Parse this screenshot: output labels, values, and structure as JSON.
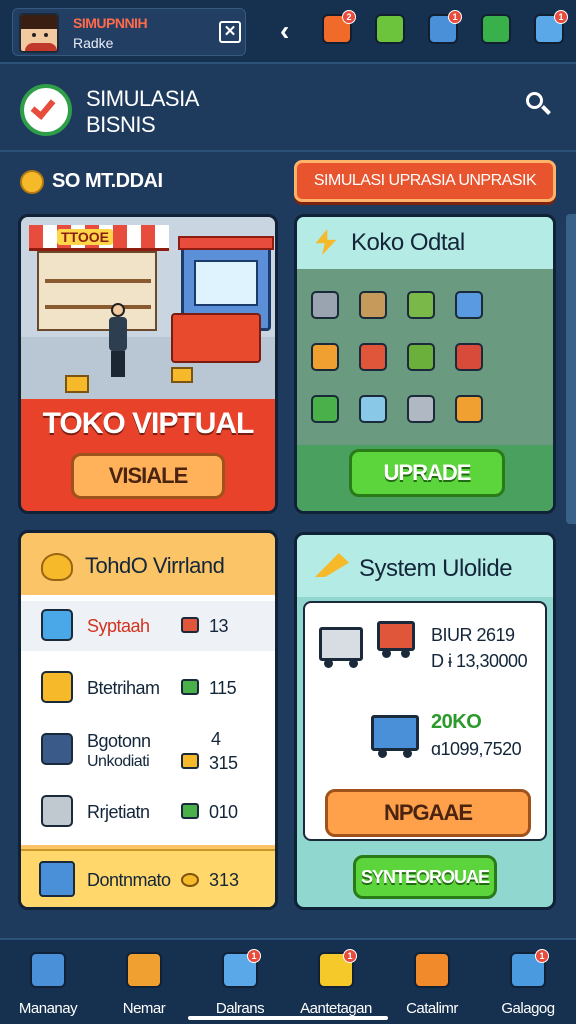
{
  "topbar": {
    "profile_name": "SIMUPNNIH",
    "profile_sub": "Radke",
    "close_glyph": "✕",
    "back_glyph": "‹",
    "icons": [
      {
        "name": "fire-icon",
        "color": "#f06a2a",
        "badge": "2"
      },
      {
        "name": "checklist-icon",
        "color": "#6cc43c",
        "badge": ""
      },
      {
        "name": "package-icon",
        "color": "#4a90d9",
        "badge": "1"
      },
      {
        "name": "money-icon",
        "color": "#3ab04a",
        "badge": ""
      },
      {
        "name": "chart-icon",
        "color": "#5aa8e8",
        "badge": "1"
      }
    ]
  },
  "header": {
    "title_line1": "SIMULASIA",
    "title_line2": "BISNIS"
  },
  "section": {
    "label": "SO MT.DDAI",
    "sim_button": "SIMULASI UPRASIA UNPRASIK"
  },
  "card_store": {
    "sign": "TTOOE",
    "title": "TOKO VIPTUAL",
    "button": "VISIALE"
  },
  "card_digital": {
    "title": "Koko Odtal",
    "button": "UPRADE",
    "items": [
      {
        "name": "server-item-icon",
        "color": "#9aa4b0"
      },
      {
        "name": "crate-item-icon",
        "color": "#c69a5a"
      },
      {
        "name": "produce-basket-icon",
        "color": "#7ab84a"
      },
      {
        "name": "cart-item-icon",
        "color": "#5a9ae0"
      },
      {
        "name": "register-item-icon",
        "color": "#f0a030"
      },
      {
        "name": "cube-item-icon",
        "color": "#e0563a"
      },
      {
        "name": "grocery-cart-icon",
        "color": "#6ab03a"
      },
      {
        "name": "fruit-crate-icon",
        "color": "#d84a3a"
      },
      {
        "name": "arcade-item-icon",
        "color": "#4ab04a"
      },
      {
        "name": "fridge-item-icon",
        "color": "#8ac8e8"
      },
      {
        "name": "atm-item-icon",
        "color": "#b0b8c4"
      },
      {
        "name": "cash-item-icon",
        "color": "#f0a030"
      }
    ]
  },
  "card_list": {
    "title": "TohdO Virrland",
    "rows": [
      {
        "label": "Syptaah",
        "value": "13",
        "icon_color": "#4aa8e8",
        "gem_color": "#e0563a"
      },
      {
        "label": "Btetriham",
        "value": "115",
        "icon_color": "#f6b92a",
        "gem_color": "#4ab04a"
      },
      {
        "label": "Bgotonn",
        "label2": "Unkodiati",
        "value_top": "4",
        "value": "315",
        "icon_color": "#3a5a8a",
        "gem_color": "#f6b92a"
      },
      {
        "label": "Rrjetiatn",
        "value": "010",
        "icon_color": "#c0c8d0",
        "gem_color": "#4ab04a"
      }
    ],
    "footer_label": "Dontnmato",
    "footer_value": "313"
  },
  "card_system": {
    "title": "System Ulolide",
    "line1": "BIUR 2619",
    "line2": "D ɨ 13,30000",
    "line3": "20KO",
    "line4": "ɑ1099,7520",
    "button_orange": "NPGAAE",
    "button_green": "SYNTEOROUAE"
  },
  "bottom_nav": [
    {
      "label": "Mananay",
      "name": "nav-home",
      "icon": "home-icon",
      "color": "#4a90d9",
      "badge": ""
    },
    {
      "label": "Nemar",
      "name": "nav-nemar",
      "icon": "pencil-icon",
      "color": "#f0a030",
      "badge": ""
    },
    {
      "label": "Dalrans",
      "name": "nav-dalrans",
      "icon": "map-icon",
      "color": "#5aa8e8",
      "badge": "1"
    },
    {
      "label": "Aantetagan",
      "name": "nav-aantetagan",
      "icon": "mail-icon",
      "color": "#f6c92a",
      "badge": "1"
    },
    {
      "label": "Catalimr",
      "name": "nav-catalimr",
      "icon": "grid-icon",
      "color": "#f08a2a",
      "badge": ""
    },
    {
      "label": "Galagog",
      "name": "nav-galagog",
      "icon": "list-icon",
      "color": "#4a9ae0",
      "badge": "1"
    }
  ]
}
